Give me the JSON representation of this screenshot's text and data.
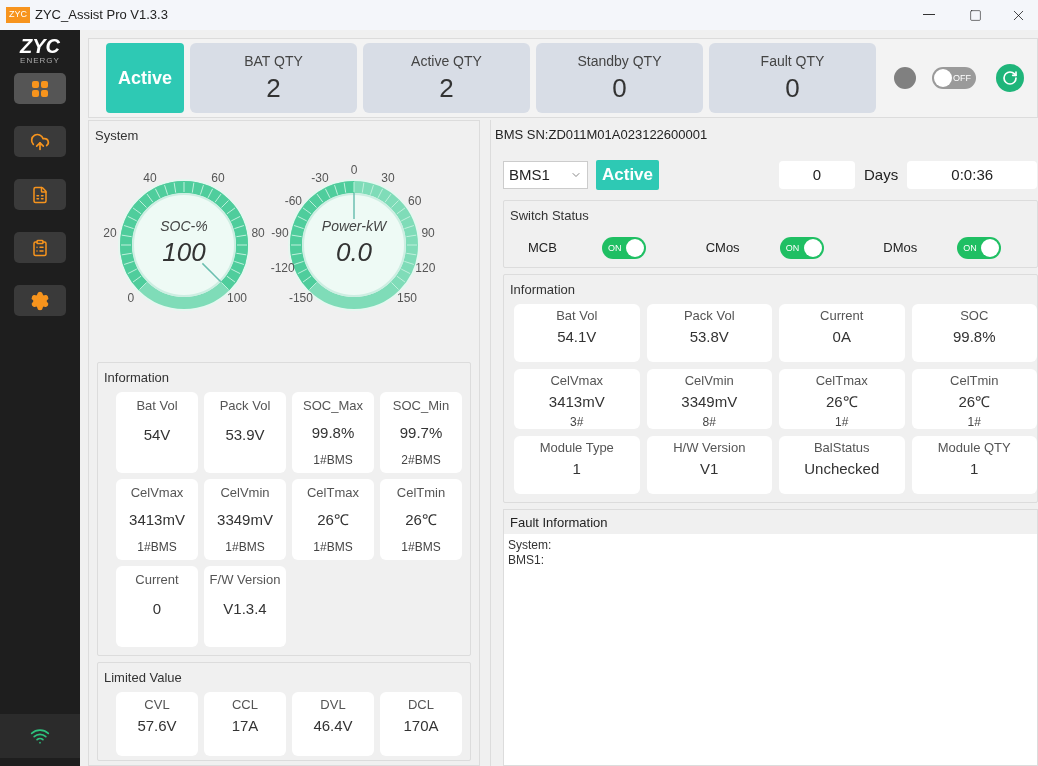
{
  "window": {
    "title": "ZYC_Assist Pro V1.3.3",
    "app_icon_text": "ZYC"
  },
  "sidebar": {
    "logo": "ZYC",
    "logo_subtitle": "ENERGY",
    "items": [
      {
        "kind": "dashboard",
        "selected": true
      },
      {
        "kind": "upload",
        "selected": false
      },
      {
        "kind": "report",
        "selected": false
      },
      {
        "kind": "log",
        "selected": false
      },
      {
        "kind": "settings",
        "selected": false
      }
    ],
    "connection": {
      "connected": true
    }
  },
  "header": {
    "status": "Active",
    "stats": [
      {
        "label": "BAT QTY",
        "value": "2"
      },
      {
        "label": "Active QTY",
        "value": "2"
      },
      {
        "label": "Standby QTY",
        "value": "0"
      },
      {
        "label": "Fault QTY",
        "value": "0"
      }
    ],
    "indicator_on": false,
    "toggle": {
      "on": false,
      "text": "OFF"
    }
  },
  "system": {
    "title": "System",
    "gauges": [
      {
        "label": "SOC-%",
        "value": "100",
        "level": 1,
        "ticks": [
          "0",
          "20",
          "40",
          "60",
          "80",
          "100"
        ]
      },
      {
        "label": "Power-kW",
        "value": "0.0",
        "level": 0.5,
        "ticks": [
          "-150",
          "-120",
          "-90",
          "-60",
          "-30",
          "0",
          "30",
          "60",
          "90",
          "120",
          "150"
        ]
      }
    ],
    "information": {
      "title": "Information",
      "cells": [
        {
          "label": "Bat Vol",
          "value": "54V"
        },
        {
          "label": "Pack Vol",
          "value": "53.9V"
        },
        {
          "label": "SOC_Max",
          "value": "99.8%",
          "sub": "1#BMS"
        },
        {
          "label": "SOC_Min",
          "value": "99.7%",
          "sub": "2#BMS"
        },
        {
          "label": "CelVmax",
          "value": "3413mV",
          "sub": "1#BMS"
        },
        {
          "label": "CelVmin",
          "value": "3349mV",
          "sub": "1#BMS"
        },
        {
          "label": "CelTmax",
          "value": "26℃",
          "sub": "1#BMS"
        },
        {
          "label": "CelTmin",
          "value": "26℃",
          "sub": "1#BMS"
        },
        {
          "label": "Current",
          "value": "0"
        },
        {
          "label": "F/W Version",
          "value": "V1.3.4"
        }
      ]
    },
    "limited": {
      "title": "Limited Value",
      "cells": [
        {
          "label": "CVL",
          "value": "57.6V"
        },
        {
          "label": "CCL",
          "value": "17A"
        },
        {
          "label": "DVL",
          "value": "46.4V"
        },
        {
          "label": "DCL",
          "value": "170A"
        }
      ]
    }
  },
  "bms": {
    "title": "BMS SN:ZD011M01A023122600001",
    "select": "BMS1",
    "status": "Active",
    "days_value": "0",
    "days_label": "Days",
    "runtime": "0:0:36",
    "switch_status": {
      "title": "Switch Status",
      "switches": [
        {
          "label": "MCB",
          "on": true,
          "text": "ON"
        },
        {
          "label": "CMos",
          "on": true,
          "text": "ON"
        },
        {
          "label": "DMos",
          "on": true,
          "text": "ON"
        }
      ]
    },
    "information": {
      "title": "Information",
      "cells": [
        {
          "label": "Bat Vol",
          "value": "54.1V"
        },
        {
          "label": "Pack Vol",
          "value": "53.8V"
        },
        {
          "label": "Current",
          "value": "0A"
        },
        {
          "label": "SOC",
          "value": "99.8%"
        },
        {
          "label": "CelVmax",
          "value": "3413mV",
          "sub": "3#"
        },
        {
          "label": "CelVmin",
          "value": "3349mV",
          "sub": "8#"
        },
        {
          "label": "CelTmax",
          "value": "26℃",
          "sub": "1#"
        },
        {
          "label": "CelTmin",
          "value": "26℃",
          "sub": "1#"
        },
        {
          "label": "Module Type",
          "value": "1"
        },
        {
          "label": "H/W Version",
          "value": "V1"
        },
        {
          "label": "BalStatus",
          "value": "Unchecked"
        },
        {
          "label": "Module QTY",
          "value": "1"
        }
      ]
    },
    "fault": {
      "title": "Fault Information",
      "lines": [
        "System:",
        "BMS1:"
      ]
    }
  }
}
